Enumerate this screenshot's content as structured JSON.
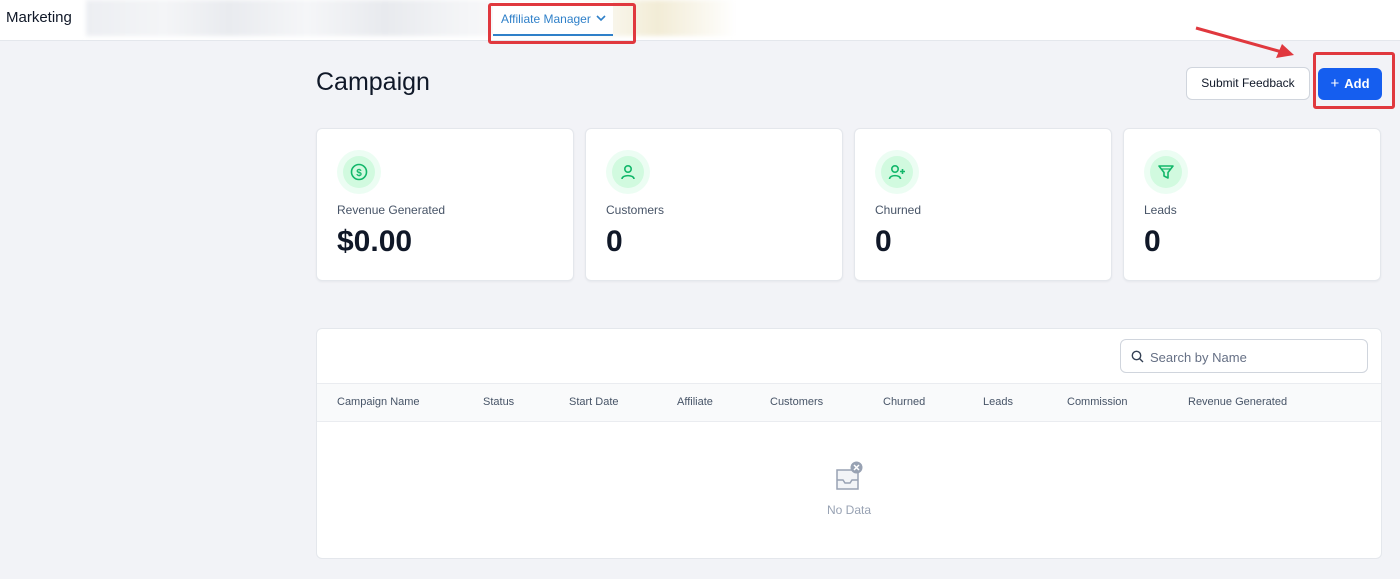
{
  "header": {
    "app_title": "Marketing",
    "active_tab": "Affiliate Manager"
  },
  "page": {
    "title": "Campaign",
    "submit_feedback_label": "Submit Feedback",
    "add_label": "Add"
  },
  "stats": [
    {
      "label": "Revenue Generated",
      "value": "$0.00",
      "icon": "dollar-icon"
    },
    {
      "label": "Customers",
      "value": "0",
      "icon": "user-icon"
    },
    {
      "label": "Churned",
      "value": "0",
      "icon": "user-plus-icon"
    },
    {
      "label": "Leads",
      "value": "0",
      "icon": "funnel-icon"
    }
  ],
  "table": {
    "search_placeholder": "Search by Name",
    "columns": [
      "Campaign Name",
      "Status",
      "Start Date",
      "Affiliate",
      "Customers",
      "Churned",
      "Leads",
      "Commission",
      "Revenue Generated"
    ],
    "rows": [],
    "empty_text": "No Data"
  },
  "colors": {
    "accent": "#155eef",
    "tab_active": "#2f80c9",
    "annotation": "#e0383e",
    "stat_icon": "#12b76a"
  }
}
